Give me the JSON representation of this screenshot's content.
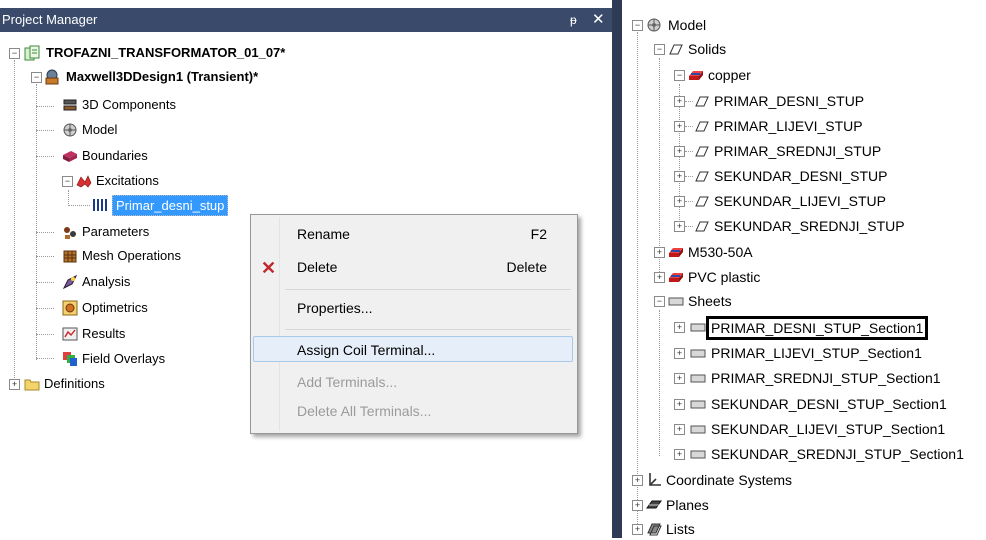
{
  "project_manager": {
    "title": "Project Manager",
    "pin_glyph": "ᵽ",
    "close_glyph": "✕",
    "project": "TROFAZNI_TRANSFORMATOR_01_07*",
    "design": "Maxwell3DDesign1 (Transient)*",
    "items": {
      "components": "3D Components",
      "model": "Model",
      "boundaries": "Boundaries",
      "excitations": "Excitations",
      "excitation_child": "Primar_desni_stup",
      "parameters": "Parameters",
      "mesh_operations": "Mesh Operations",
      "analysis": "Analysis",
      "optimetrics": "Optimetrics",
      "results": "Results",
      "field_overlays": "Field Overlays",
      "definitions": "Definitions"
    }
  },
  "context_menu": {
    "rename": "Rename",
    "rename_shortcut": "F2",
    "delete": "Delete",
    "delete_shortcut": "Delete",
    "properties": "Properties...",
    "assign_coil_terminal": "Assign Coil Terminal...",
    "add_terminals": "Add Terminals...",
    "delete_all_terminals": "Delete All Terminals..."
  },
  "model_tree": {
    "model": "Model",
    "solids": "Solids",
    "copper": "copper",
    "copper_items": [
      "PRIMAR_DESNI_STUP",
      "PRIMAR_LIJEVI_STUP",
      "PRIMAR_SREDNJI_STUP",
      "SEKUNDAR_DESNI_STUP",
      "SEKUNDAR_LIJEVI_STUP",
      "SEKUNDAR_SREDNJI_STUP"
    ],
    "m530": "M530-50A",
    "pvc": "PVC plastic",
    "sheets": "Sheets",
    "sheet_items": [
      "PRIMAR_DESNI_STUP_Section1",
      "PRIMAR_LIJEVI_STUP_Section1",
      "PRIMAR_SREDNJI_STUP_Section1",
      "SEKUNDAR_DESNI_STUP_Section1",
      "SEKUNDAR_LIJEVI_STUP_Section1",
      "SEKUNDAR_SREDNJI_STUP_Section1"
    ],
    "coordinate_systems": "Coordinate Systems",
    "planes": "Planes",
    "lists": "Lists"
  },
  "colors": {
    "title_bar": "#3a4a6a",
    "splitter": "#2f3b55",
    "selection": "#3399ff",
    "copper_material": "#e0202a",
    "delete_icon": "#c0282d"
  }
}
